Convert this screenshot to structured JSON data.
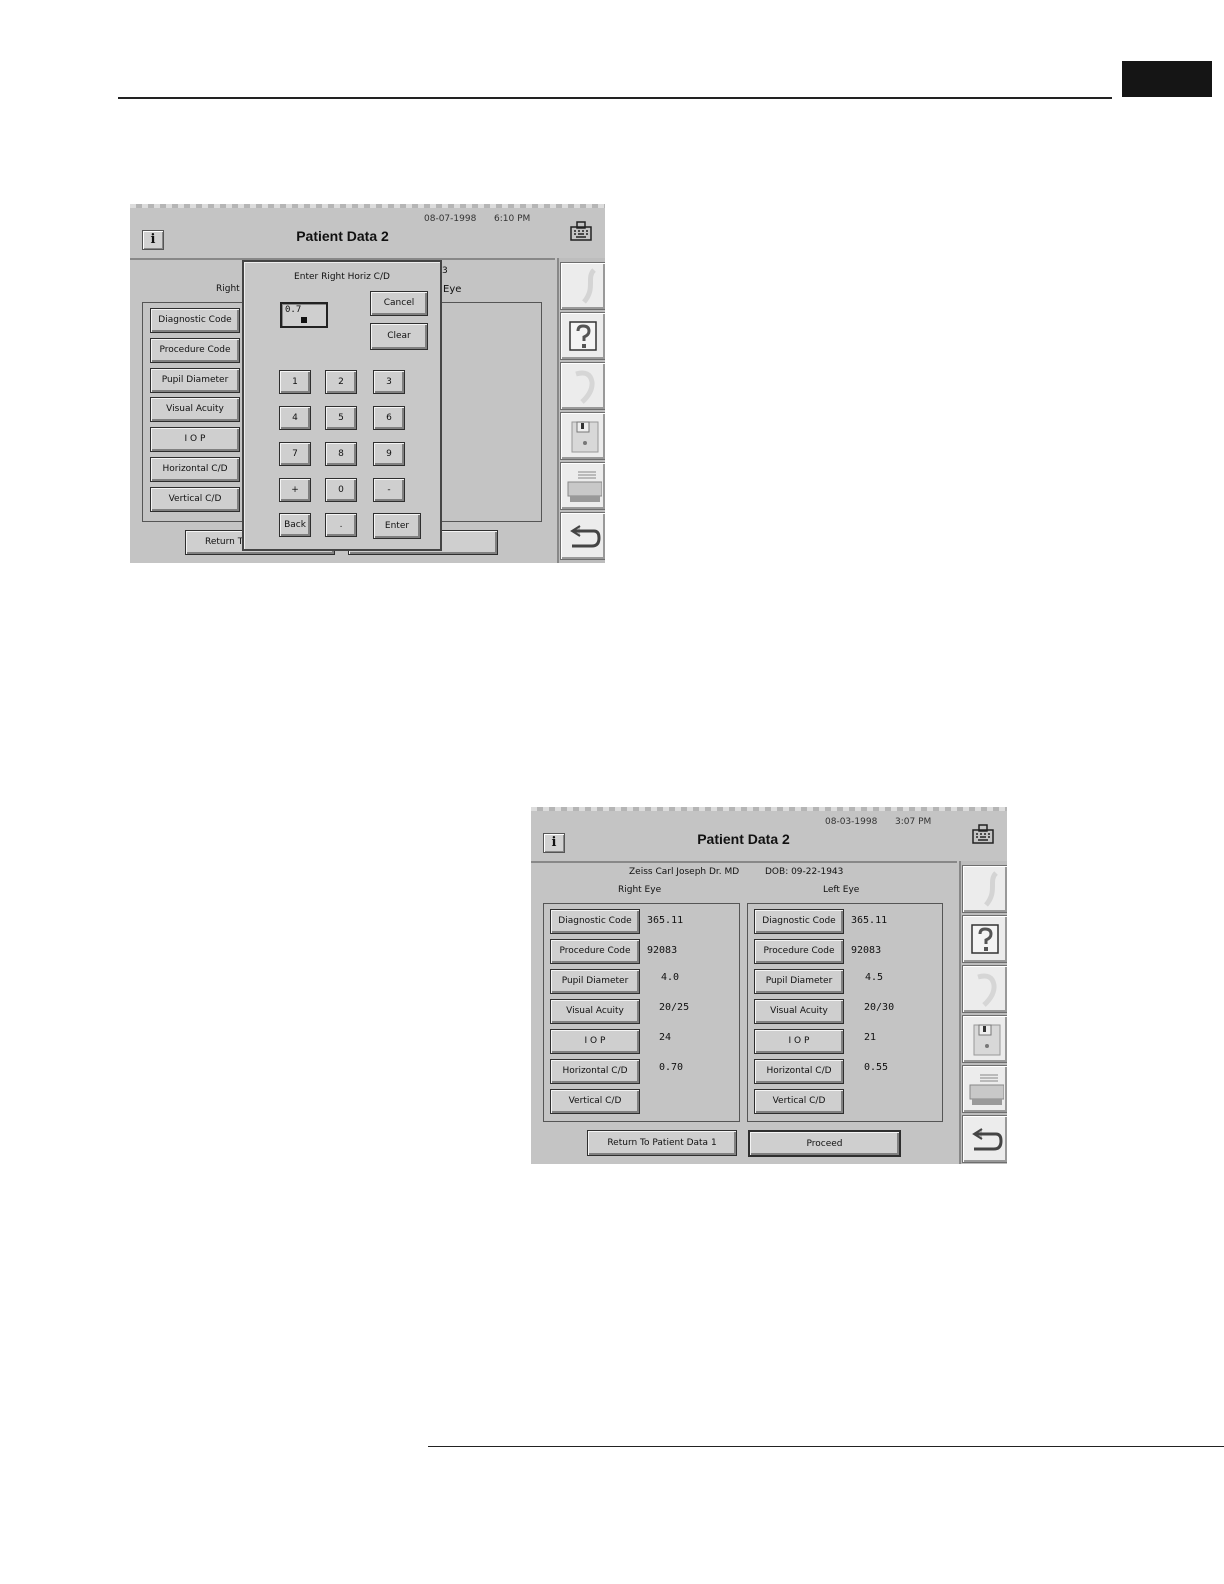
{
  "screen1": {
    "date": "08-07-1998",
    "time": "6:10 PM",
    "title": "Patient Data 2",
    "dialog": {
      "title": "Enter Right Horiz C/D",
      "entry_value": "0.7",
      "cancel_label": "Cancel",
      "clear_label": "Clear",
      "keys": [
        "1",
        "2",
        "3",
        "4",
        "5",
        "6",
        "7",
        "8",
        "9",
        "+",
        "0",
        "-",
        "Back",
        ".",
        "Enter"
      ]
    },
    "right_label_partial": "Right",
    "header_fragment": "3",
    "eye_fragment": "Eye",
    "buttons": [
      "Diagnostic Code",
      "Procedure Code",
      "Pupil Diameter",
      "Visual Acuity",
      "I O P",
      "Horizontal C/D",
      "Vertical C/D"
    ],
    "return_partial": "Return T"
  },
  "screen2": {
    "date": "08-03-1998",
    "time": "3:07 PM",
    "title": "Patient Data 2",
    "patient_name": "Zeiss Carl Joseph Dr. MD",
    "dob": "DOB:  09-22-1943",
    "right_eye_label": "Right Eye",
    "left_eye_label": "Left Eye",
    "right_eye": [
      {
        "label": "Diagnostic Code",
        "value": "365.11"
      },
      {
        "label": "Procedure Code",
        "value": "92083"
      },
      {
        "label": "Pupil Diameter",
        "value": "4.0"
      },
      {
        "label": "Visual Acuity",
        "value": "20/25"
      },
      {
        "label": "I O P",
        "value": "24"
      },
      {
        "label": "Horizontal C/D",
        "value": "0.70"
      },
      {
        "label": "Vertical C/D",
        "value": ""
      }
    ],
    "left_eye": [
      {
        "label": "Diagnostic Code",
        "value": "365.11"
      },
      {
        "label": "Procedure Code",
        "value": "92083"
      },
      {
        "label": "Pupil Diameter",
        "value": "4.5"
      },
      {
        "label": "Visual Acuity",
        "value": "20/30"
      },
      {
        "label": "I O P",
        "value": "21"
      },
      {
        "label": "Horizontal C/D",
        "value": "0.55"
      },
      {
        "label": "Vertical C/D",
        "value": ""
      }
    ],
    "return_label": "Return To Patient Data 1",
    "proceed_label": "Proceed"
  },
  "icons": {
    "info": "i",
    "sidebar": [
      "blank-icon",
      "help-icon",
      "ear-icon",
      "floppy-disk-icon",
      "printer-icon",
      "return-arrow-icon"
    ],
    "keyboard": "keyboard-icon"
  }
}
